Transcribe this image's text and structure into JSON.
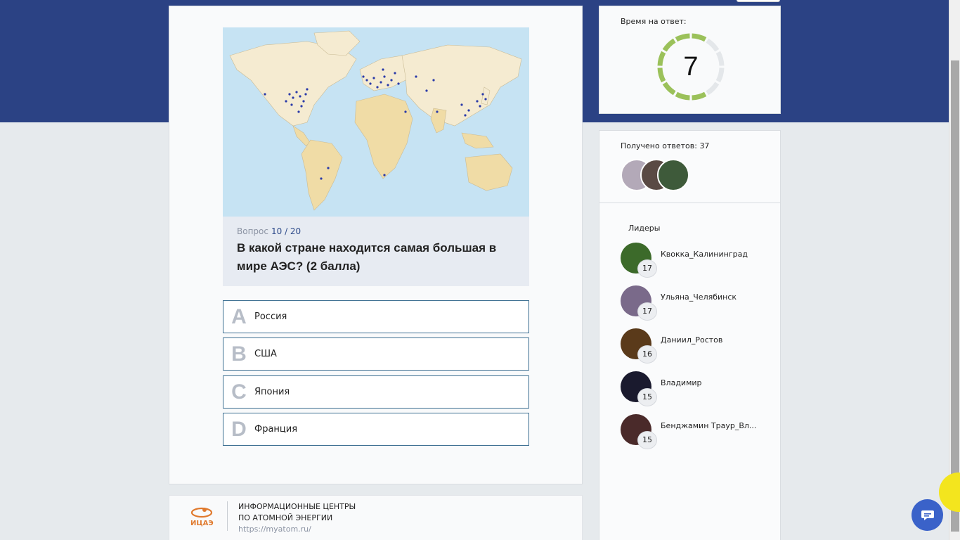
{
  "quiz": {
    "map_image_alt": "",
    "question_meta_label": "Вопрос",
    "question_number": "10 / 20",
    "question_text": "В какой стране находится самая большая в мире АЭС? (2 балла)",
    "answers": [
      {
        "letter": "A",
        "label": "Россия"
      },
      {
        "letter": "B",
        "label": "США"
      },
      {
        "letter": "C",
        "label": "Япония"
      },
      {
        "letter": "D",
        "label": "Франция"
      }
    ]
  },
  "footer": {
    "logo_text": "ИЦАЭ",
    "title_line1": "ИНФОРМАЦИОННЫЕ ЦЕНТРЫ",
    "title_line2": "ПО АТОМНОЙ ЭНЕРГИИ",
    "link": "https://myatom.ru/"
  },
  "timer": {
    "label": "Время на ответ:",
    "value": "7",
    "remaining_fraction": 0.7
  },
  "answers_received": {
    "label": "Получено ответов: 37"
  },
  "leaders": {
    "title": "Лидеры",
    "items": [
      {
        "name": "Квокка_Калининград",
        "score": "17",
        "color": "#3c6a2a"
      },
      {
        "name": "Ульяна_Челябинск",
        "score": "17",
        "color": "#7a6a8a"
      },
      {
        "name": "Даниил_Ростов",
        "score": "16",
        "color": "#5a3a1a"
      },
      {
        "name": "Владимир",
        "score": "15",
        "color": "#1a1a2e"
      },
      {
        "name": "Бенджамин Траур_Вл...",
        "score": "15",
        "color": "#4a2a2a"
      }
    ]
  },
  "colors": {
    "header_band": "#2b4284",
    "timer_ring": "#9bc15a",
    "answer_border": "#3d6f92",
    "chat_button": "#3a62c9"
  }
}
